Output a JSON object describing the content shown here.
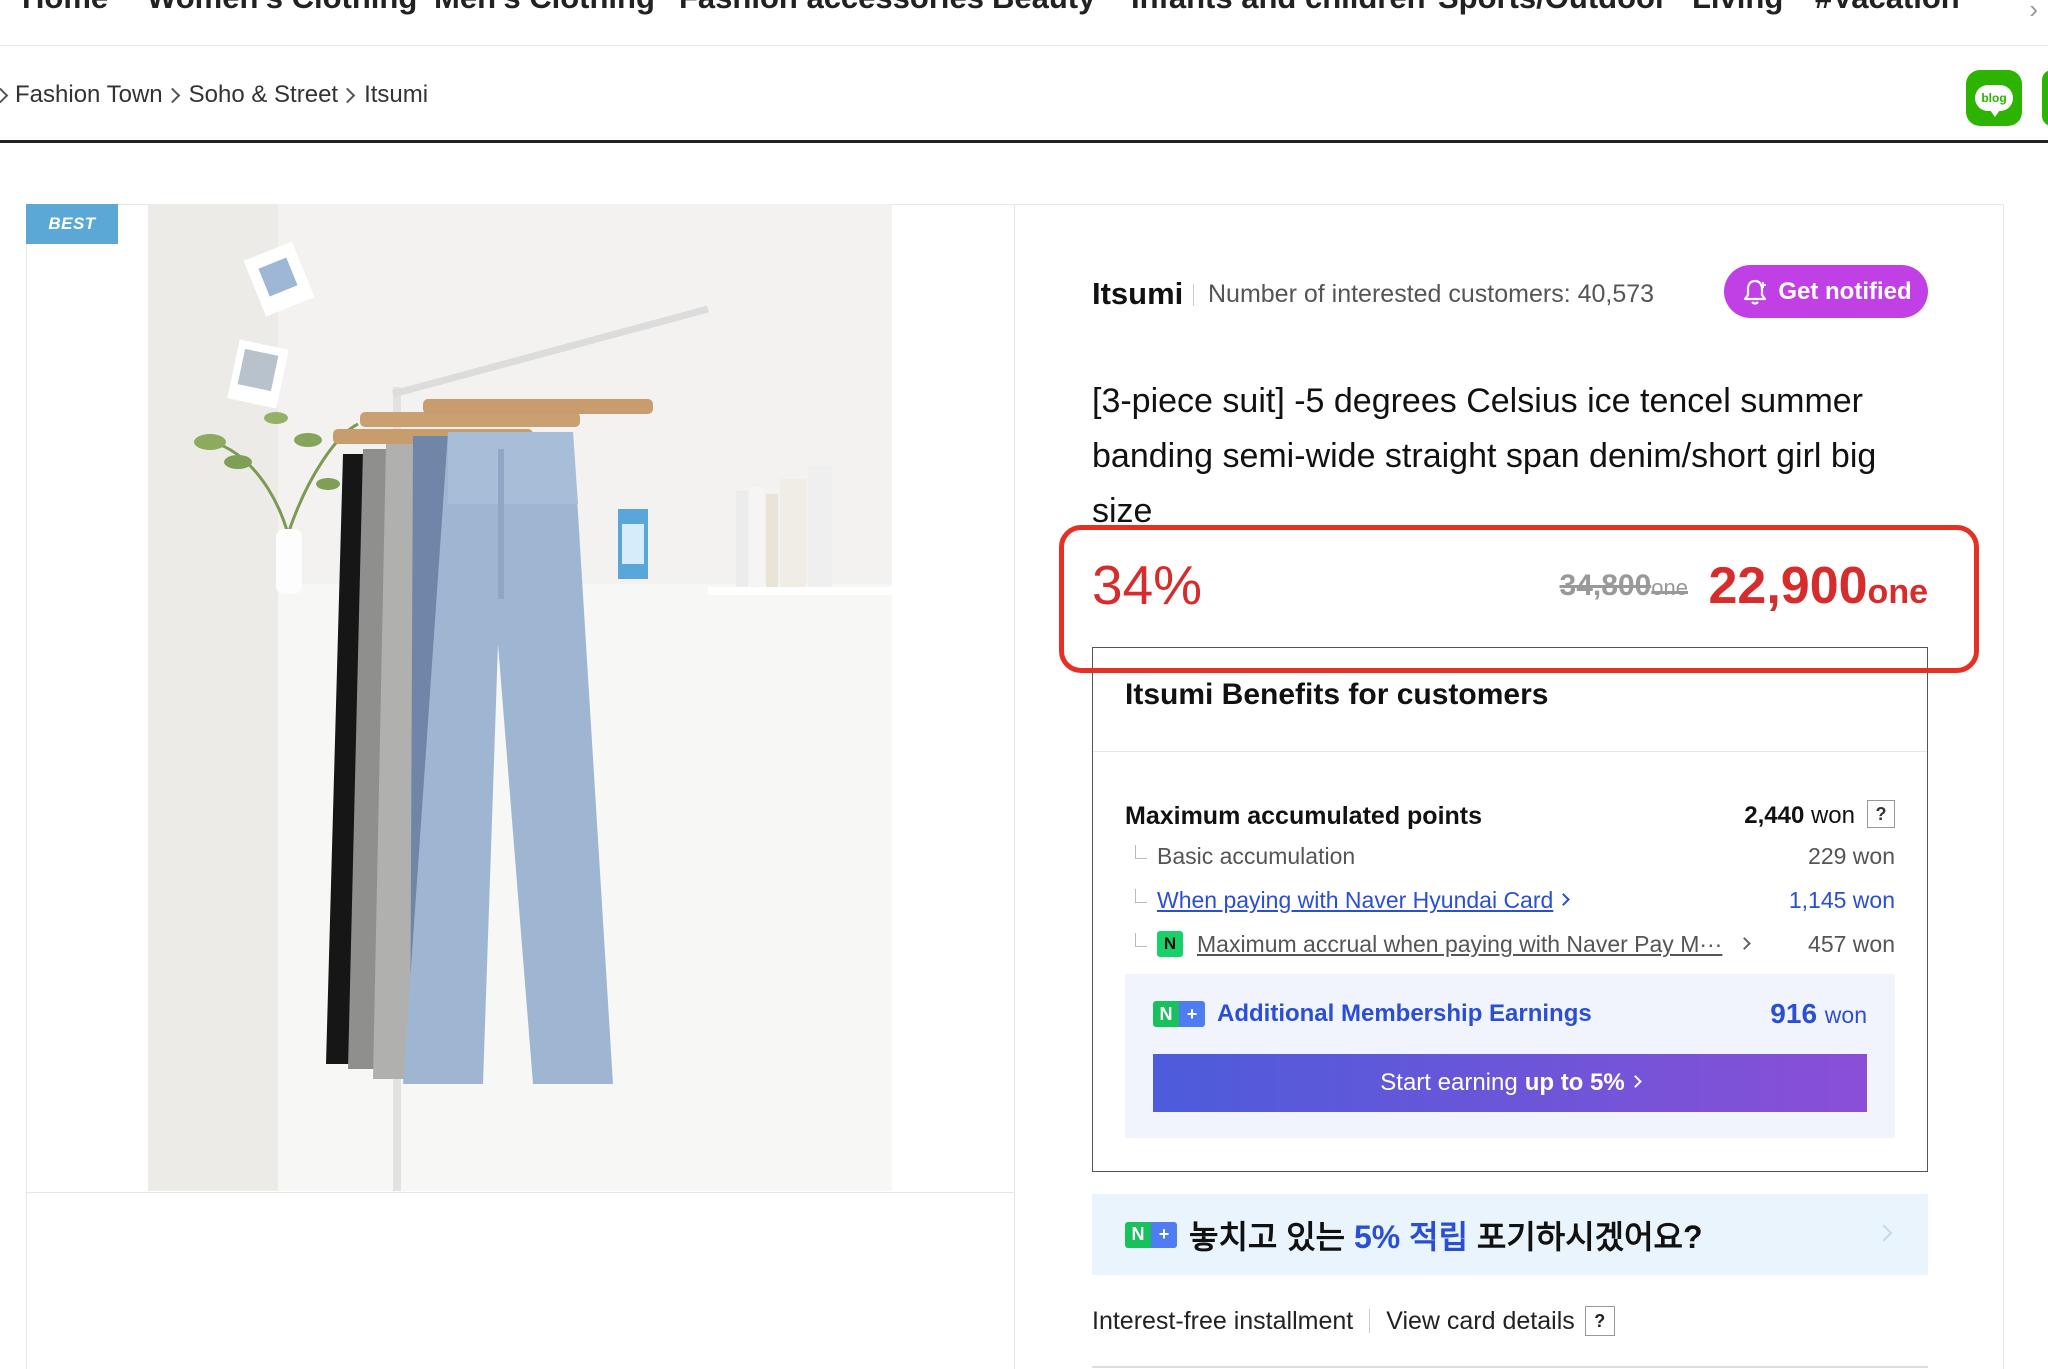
{
  "top_nav": {
    "items": [
      "Home",
      "Women's Clothing",
      "Men's Clothing",
      "Fashion accessories",
      "Beauty",
      "Infants and children",
      "Sports/Outdoor",
      "Living",
      "#Vacation"
    ]
  },
  "breadcrumb": [
    "Fashion Town",
    "Soho & Street",
    "Itsumi"
  ],
  "blog_button": {
    "label": "blog"
  },
  "product": {
    "badge": "BEST",
    "seller": "Itsumi",
    "interested": "Number of interested customers: 40,573",
    "notify_label": "Get notified",
    "title": "[3-piece suit] -5 degrees Celsius ice tencel summer banding semi-wide straight span denim/short girl big size",
    "discount": "34%",
    "original_price": "34,800",
    "original_unit": "one",
    "sale_price": "22,900",
    "sale_unit": "one"
  },
  "benefits": {
    "heading": "Itsumi Benefits for customers",
    "max_points_label": "Maximum accumulated points",
    "max_points_value": "2,440",
    "max_points_unit": "won",
    "help": "?",
    "basic_label": "Basic accumulation",
    "basic_value": "229 won",
    "hyundai_label": "When paying with Naver Hyundai Card",
    "hyundai_value": "1,145 won",
    "npay_label": "Maximum accrual when paying with Naver Pay M···",
    "npay_value": "457 won",
    "npay_mark": "N",
    "membership_label": "Additional Membership Earnings",
    "membership_value": "916",
    "membership_unit": "won",
    "earn_prefix": "Start earning",
    "earn_bold": "up to 5%"
  },
  "promo": {
    "text_before": "놓치고 있는",
    "text_highlight": "5% 적립",
    "text_after": "포기하시겠어요?"
  },
  "installment": {
    "label": "Interest-free installment",
    "link": "View card details",
    "help": "?"
  },
  "colors": {
    "accent_red": "#d62c2c",
    "notify_purple": "#c140e6",
    "naver_green": "#19c15d",
    "link_blue": "#2a4fd3",
    "highlight_stroke": "#e53023"
  }
}
